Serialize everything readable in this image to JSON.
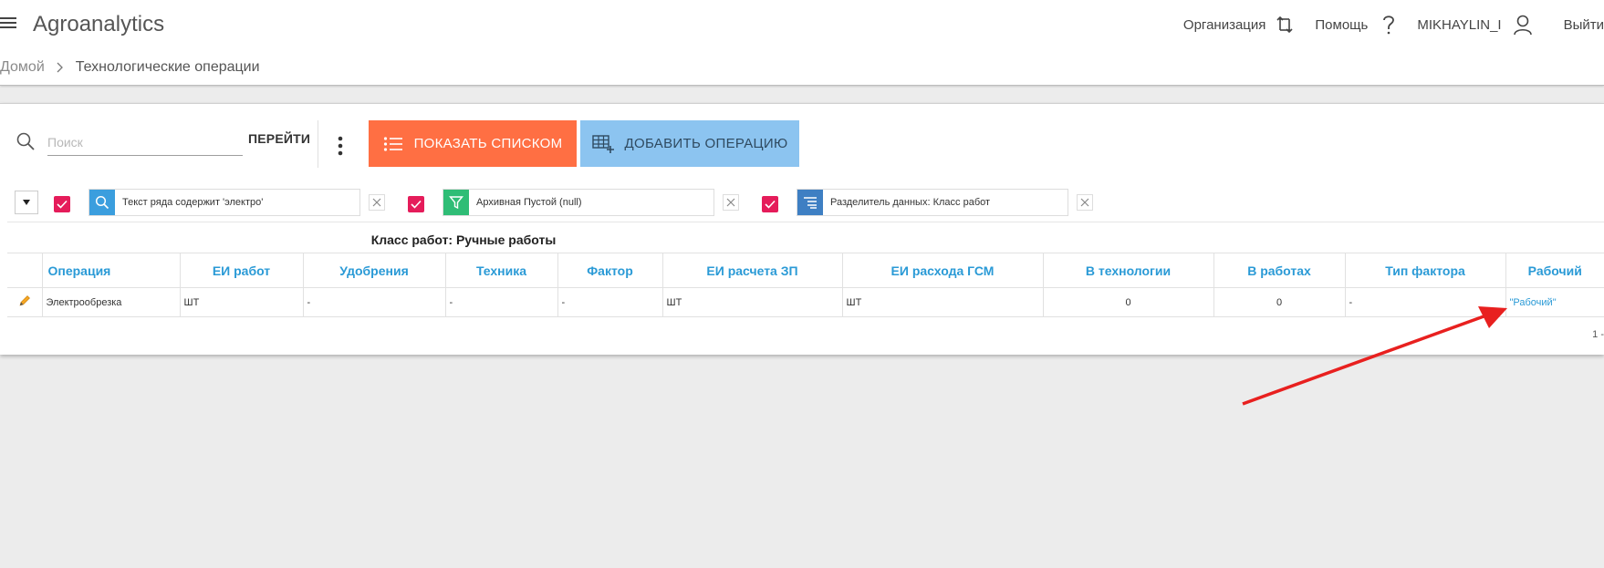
{
  "header": {
    "app_title": "Agroanalytics",
    "organization_label": "Организация",
    "help_label": "Помощь",
    "user_label": "MIKHAYLIN_I",
    "logout_label": "Выйти"
  },
  "breadcrumb": {
    "home": "Домой",
    "current": "Технологические операции"
  },
  "toolbar": {
    "search_placeholder": "Поиск",
    "go_label": "ПЕРЕЙТИ",
    "show_list_label": "ПОКАЗАТЬ СПИСКОМ",
    "add_operation_label": "ДОБАВИТЬ ОПЕРАЦИЮ"
  },
  "filters": [
    {
      "text": "Текст ряда содержит 'электро'",
      "icon": "search-icon",
      "color": "#3b9ede",
      "checked": true
    },
    {
      "text": "Архивная Пустой (null)",
      "icon": "filter-icon",
      "color": "#2fbd76",
      "checked": true
    },
    {
      "text": "Разделитель данных: Класс работ",
      "icon": "group-icon",
      "color": "#3e7fc3",
      "checked": true
    }
  ],
  "group_title": "Класс работ: Ручные работы",
  "table": {
    "columns": [
      "Операция",
      "ЕИ работ",
      "Удобрения",
      "Техника",
      "Фактор",
      "ЕИ расчета ЗП",
      "ЕИ расхода ГСМ",
      "В технологии",
      "В работах",
      "Тип фактора",
      "Рабочий"
    ],
    "rows": [
      [
        "Электрообрезка",
        "ШТ",
        "-",
        "-",
        "-",
        "ШТ",
        "ШТ",
        "0",
        "0",
        "-",
        "\"Рабочий\""
      ]
    ]
  },
  "pager_text": "1 -",
  "colors": {
    "accent_orange": "#ff6f43",
    "accent_blue": "#8cc4f0",
    "link_blue": "#2a9ad6",
    "checkbox_pink": "#e51c5a",
    "annotation_arrow": "#e8201f"
  }
}
